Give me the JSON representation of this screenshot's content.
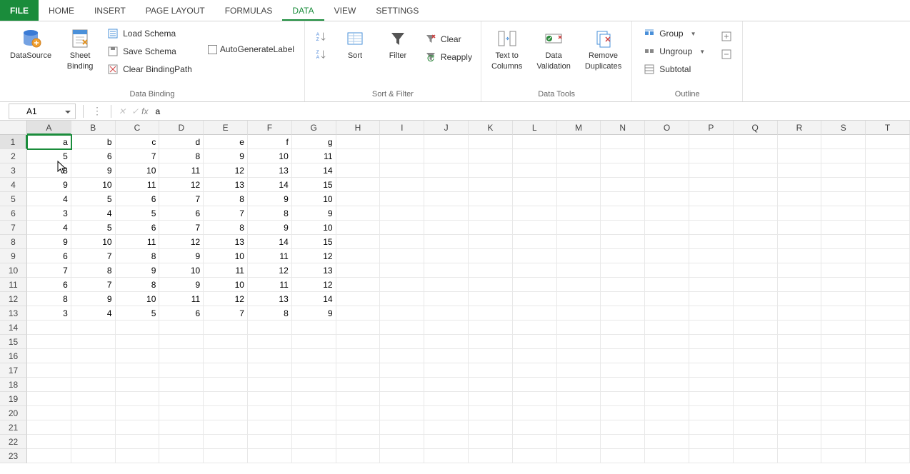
{
  "tabs": {
    "file": "FILE",
    "items": [
      "HOME",
      "INSERT",
      "PAGE LAYOUT",
      "FORMULAS",
      "DATA",
      "VIEW",
      "SETTINGS"
    ],
    "active": "DATA"
  },
  "ribbon": {
    "data_binding": {
      "datasource": "DataSource",
      "sheet_binding_l1": "Sheet",
      "sheet_binding_l2": "Binding",
      "load_schema": "Load Schema",
      "save_schema": "Save Schema",
      "clear_bindingpath": "Clear BindingPath",
      "autogen": "AutoGenerateLabel",
      "group_label": "Data Binding"
    },
    "sort_filter": {
      "sort": "Sort",
      "filter": "Filter",
      "clear": "Clear",
      "reapply": "Reapply",
      "group_label": "Sort & Filter"
    },
    "data_tools": {
      "text_to_columns_l1": "Text to",
      "text_to_columns_l2": "Columns",
      "data_validation_l1": "Data",
      "data_validation_l2": "Validation",
      "remove_duplicates_l1": "Remove",
      "remove_duplicates_l2": "Duplicates",
      "group_label": "Data Tools"
    },
    "outline": {
      "group": "Group",
      "ungroup": "Ungroup",
      "subtotal": "Subtotal",
      "group_label": "Outline"
    }
  },
  "formula_bar": {
    "cell_ref": "A1",
    "formula": "a"
  },
  "grid": {
    "columns": [
      "A",
      "B",
      "C",
      "D",
      "E",
      "F",
      "G",
      "H",
      "I",
      "J",
      "K",
      "L",
      "M",
      "N",
      "O",
      "P",
      "Q",
      "R",
      "S",
      "T"
    ],
    "row_count": 23,
    "active_col": "A",
    "active_row": 1,
    "data": [
      [
        "a",
        "b",
        "c",
        "d",
        "e",
        "f",
        "g"
      ],
      [
        "5",
        "6",
        "7",
        "8",
        "9",
        "10",
        "11"
      ],
      [
        "8",
        "9",
        "10",
        "11",
        "12",
        "13",
        "14"
      ],
      [
        "9",
        "10",
        "11",
        "12",
        "13",
        "14",
        "15"
      ],
      [
        "4",
        "5",
        "6",
        "7",
        "8",
        "9",
        "10"
      ],
      [
        "3",
        "4",
        "5",
        "6",
        "7",
        "8",
        "9"
      ],
      [
        "4",
        "5",
        "6",
        "7",
        "8",
        "9",
        "10"
      ],
      [
        "9",
        "10",
        "11",
        "12",
        "13",
        "14",
        "15"
      ],
      [
        "6",
        "7",
        "8",
        "9",
        "10",
        "11",
        "12"
      ],
      [
        "7",
        "8",
        "9",
        "10",
        "11",
        "12",
        "13"
      ],
      [
        "6",
        "7",
        "8",
        "9",
        "10",
        "11",
        "12"
      ],
      [
        "8",
        "9",
        "10",
        "11",
        "12",
        "13",
        "14"
      ],
      [
        "3",
        "4",
        "5",
        "6",
        "7",
        "8",
        "9"
      ]
    ]
  }
}
